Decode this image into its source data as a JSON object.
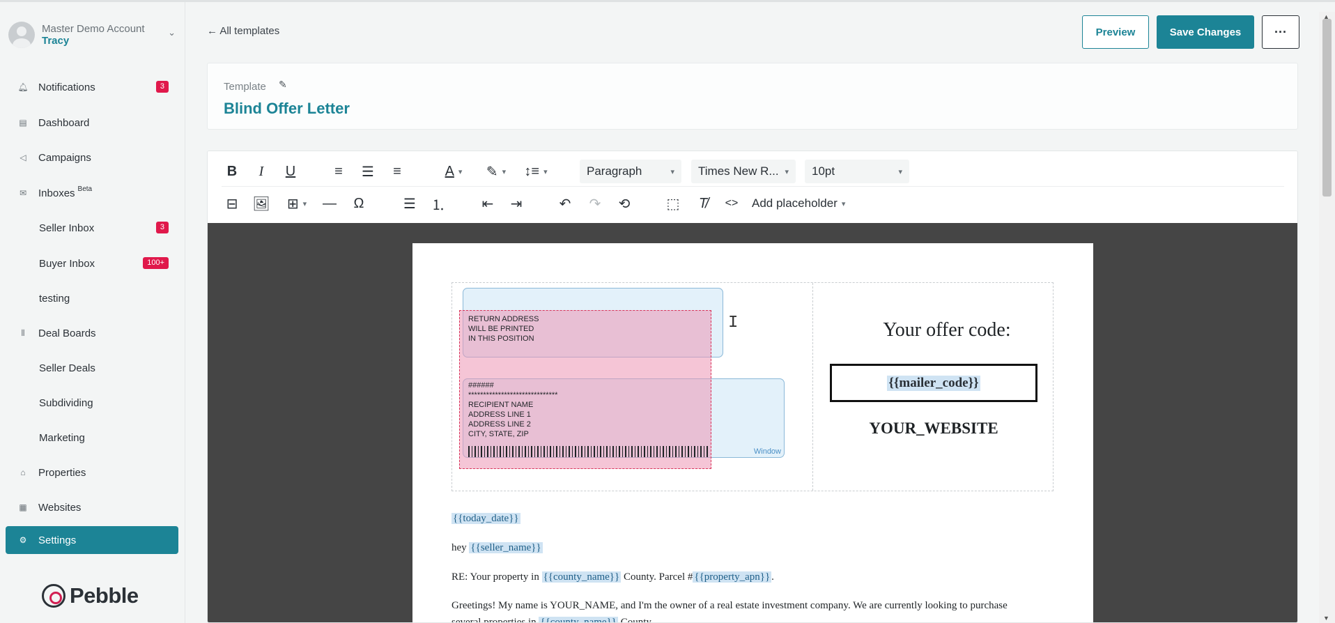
{
  "account": {
    "name": "Master Demo Account",
    "user": "Tracy"
  },
  "sidebar": {
    "items": [
      {
        "label": "Notifications",
        "badge": "3",
        "icon": "bell-icon"
      },
      {
        "label": "Dashboard",
        "icon": "dashboard-icon"
      },
      {
        "label": "Campaigns",
        "icon": "megaphone-icon"
      },
      {
        "label": "Inboxes",
        "superscript": "Beta",
        "icon": "inbox-icon"
      },
      {
        "label": "Seller Inbox",
        "badge": "3"
      },
      {
        "label": "Buyer Inbox",
        "badge": "100+"
      },
      {
        "label": "testing"
      },
      {
        "label": "Deal Boards",
        "icon": "board-icon"
      },
      {
        "label": "Seller Deals"
      },
      {
        "label": "Subdividing"
      },
      {
        "label": "Marketing"
      },
      {
        "label": "Properties",
        "icon": "properties-icon"
      },
      {
        "label": "Websites",
        "icon": "websites-icon"
      },
      {
        "label": "Settings",
        "icon": "gear-icon"
      }
    ],
    "logo": "Pebble"
  },
  "header": {
    "back_link": "All templates",
    "preview_label": "Preview",
    "save_label": "Save Changes",
    "more_label": "···"
  },
  "template": {
    "label": "Template",
    "title": "Blind Offer Letter"
  },
  "toolbar": {
    "block_format": "Paragraph",
    "font_family": "Times New R...",
    "font_size": "10pt",
    "add_placeholder": "Add placeholder"
  },
  "letter": {
    "return_address": "RETURN ADDRESS\nWILL BE PRINTED\nIN THIS POSITION",
    "recipient_block": "######\n******************************\nRECIPIENT NAME\nADDRESS LINE 1\nADDRESS LINE 2\nCITY, STATE, ZIP",
    "window_label": "Window",
    "offer_code_title": "Your offer code:",
    "mailer_code": "{{mailer_code}}",
    "website": "YOUR_WEBSITE",
    "today_date": "{{today_date}}",
    "greeting_prefix": "hey ",
    "seller_name": "{{seller_name}}",
    "re_prefix": "RE: Your property in ",
    "county_name": "{{county_name}}",
    "re_mid": " County. Parcel #",
    "property_apn": "{{property_apn}}",
    "re_suffix": ".",
    "paragraph1": "Greetings! My name is YOUR_NAME, and I'm the owner of a real estate investment company. We are currently looking to purchase",
    "paragraph1_cont_prefix": "several properties in ",
    "paragraph1_cont_suffix": " County."
  },
  "colors": {
    "accent": "#1c8496",
    "badge": "#e0194b",
    "canvas": "#454545"
  }
}
